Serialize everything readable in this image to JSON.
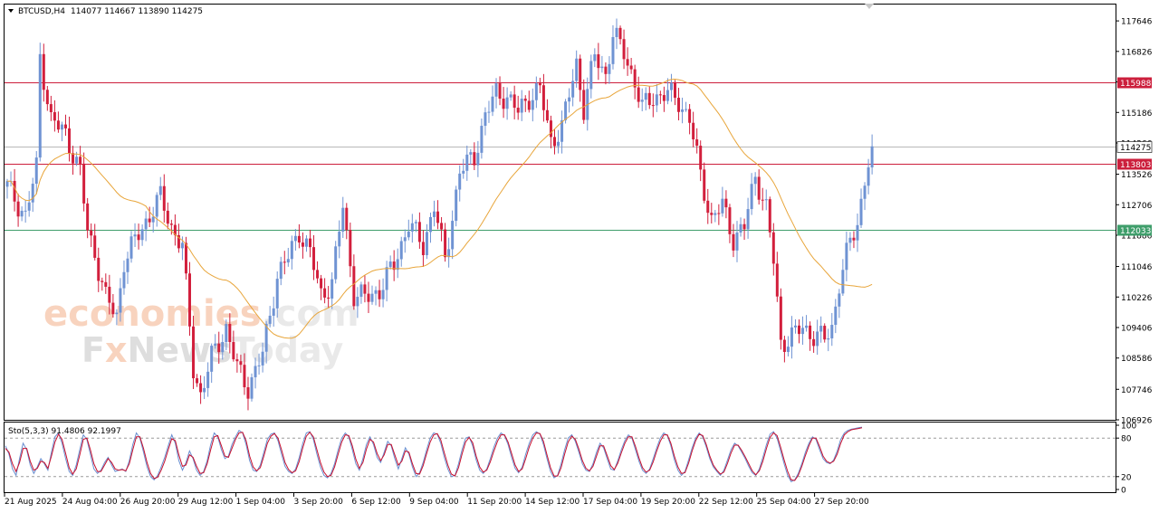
{
  "header": {
    "symbol": "BTCUSD,H4",
    "ohlc": "114077 114667 113890 114275"
  },
  "watermark": {
    "line1_main": "economies",
    "line1_suffix": ".com",
    "line2_prefix": "F",
    "line2_mid": "News",
    "line2_suffix": "Today"
  },
  "chart_data": [
    {
      "type": "candlestick",
      "title": "BTCUSD,H4",
      "ylim": [
        106926,
        118086
      ],
      "yticks": [
        "117646",
        "116826",
        "116006",
        "115186",
        "114366",
        "113526",
        "112706",
        "111886",
        "111046",
        "110226",
        "109406",
        "108586",
        "107746",
        "106926"
      ],
      "xticks": [
        "21 Aug 2025",
        "24 Aug 04:00",
        "26 Aug 20:00",
        "29 Aug 12:00",
        "1 Sep 04:00",
        "3 Sep 20:00",
        "6 Sep 12:00",
        "9 Sep 04:00",
        "11 Sep 20:00",
        "14 Sep 12:00",
        "17 Sep 04:00",
        "19 Sep 20:00",
        "22 Sep 12:00",
        "25 Sep 04:00",
        "27 Sep 20:00"
      ],
      "current_price": "114275",
      "levels": [
        {
          "label": "115988",
          "value": 115988,
          "color": "#cc1f3c"
        },
        {
          "label": "113803",
          "value": 113803,
          "color": "#cc1f3c"
        },
        {
          "label": "112033",
          "value": 112033,
          "color": "#3f9e6b"
        }
      ],
      "anchors": [
        [
          0,
          113200
        ],
        [
          5,
          112400
        ],
        [
          8,
          113700
        ],
        [
          9,
          116700
        ],
        [
          12,
          115000
        ],
        [
          16,
          114600
        ],
        [
          20,
          113600
        ],
        [
          22,
          112000
        ],
        [
          24,
          111400
        ],
        [
          27,
          110200
        ],
        [
          30,
          109700
        ],
        [
          32,
          111200
        ],
        [
          36,
          111900
        ],
        [
          40,
          112600
        ],
        [
          42,
          112900
        ],
        [
          45,
          112100
        ],
        [
          48,
          111600
        ],
        [
          51,
          108300
        ],
        [
          53,
          107600
        ],
        [
          56,
          108600
        ],
        [
          60,
          109400
        ],
        [
          63,
          108300
        ],
        [
          66,
          107800
        ],
        [
          70,
          108700
        ],
        [
          74,
          110800
        ],
        [
          77,
          111300
        ],
        [
          80,
          112000
        ],
        [
          83,
          111400
        ],
        [
          86,
          110300
        ],
        [
          89,
          110600
        ],
        [
          92,
          112700
        ],
        [
          95,
          110300
        ],
        [
          98,
          110200
        ],
        [
          102,
          110400
        ],
        [
          106,
          111100
        ],
        [
          110,
          112200
        ],
        [
          114,
          111600
        ],
        [
          117,
          112700
        ],
        [
          120,
          111200
        ],
        [
          124,
          113600
        ],
        [
          128,
          114000
        ],
        [
          131,
          115100
        ],
        [
          134,
          115700
        ],
        [
          137,
          115600
        ],
        [
          140,
          115200
        ],
        [
          143,
          115600
        ],
        [
          146,
          115800
        ],
        [
          149,
          114400
        ],
        [
          152,
          114800
        ],
        [
          156,
          116500
        ],
        [
          158,
          115300
        ],
        [
          161,
          116700
        ],
        [
          164,
          116200
        ],
        [
          166,
          117300
        ],
        [
          169,
          116800
        ],
        [
          172,
          116000
        ],
        [
          174,
          115300
        ],
        [
          177,
          115600
        ],
        [
          181,
          115700
        ],
        [
          184,
          115500
        ],
        [
          187,
          115000
        ],
        [
          190,
          113500
        ],
        [
          193,
          112300
        ],
        [
          196,
          112700
        ],
        [
          199,
          111800
        ],
        [
          202,
          112100
        ],
        [
          205,
          113500
        ],
        [
          208,
          112600
        ],
        [
          210,
          111200
        ],
        [
          212,
          109000
        ],
        [
          214,
          109100
        ],
        [
          218,
          109400
        ],
        [
          221,
          109200
        ],
        [
          224,
          109100
        ],
        [
          226,
          109400
        ],
        [
          228,
          110600
        ],
        [
          231,
          111700
        ],
        [
          233,
          112200
        ],
        [
          235,
          113400
        ],
        [
          237,
          114275
        ]
      ],
      "ma": {
        "name": "",
        "period": 30,
        "color": "#e8a53a"
      }
    },
    {
      "type": "line",
      "title": "Sto(5,3,3) 91.4806 92.1997",
      "ylim": [
        0,
        100
      ],
      "levels": [
        {
          "label": "80",
          "value": 80
        },
        {
          "label": "20",
          "value": 20
        }
      ],
      "yticks": [
        "100",
        "80",
        "20",
        "0"
      ],
      "series": [
        {
          "name": "",
          "color": "#6a8fd0",
          "values": [
            68,
            55,
            32,
            22,
            48,
            72,
            62,
            38,
            25,
            35,
            48,
            40,
            30,
            58,
            82,
            88,
            72,
            48,
            28,
            22,
            38,
            62,
            85,
            78,
            55,
            32,
            25,
            30,
            42,
            50,
            38,
            28,
            30,
            32,
            28,
            45,
            70,
            88,
            80,
            58,
            35,
            20,
            15,
            22,
            35,
            50,
            68,
            85,
            72,
            45,
            30,
            42,
            60,
            48,
            30,
            22,
            28,
            45,
            70,
            88,
            82,
            62,
            48,
            52,
            70,
            82,
            92,
            88,
            70,
            45,
            30,
            28,
            38,
            58,
            78,
            86,
            88,
            76,
            55,
            36,
            28,
            25,
            32,
            50,
            72,
            88,
            90,
            78,
            55,
            35,
            22,
            18,
            25,
            40,
            62,
            80,
            88,
            82,
            62,
            40,
            30,
            48,
            70,
            82,
            70,
            50,
            42,
            58,
            75,
            68,
            48,
            32,
            48,
            65,
            55,
            35,
            20,
            26,
            42,
            62,
            80,
            88,
            86,
            72,
            50,
            32,
            20,
            22,
            40,
            62,
            80,
            82,
            68,
            46,
            30,
            25,
            32,
            48,
            66,
            80,
            88,
            84,
            70,
            50,
            33,
            26,
            35,
            55,
            72,
            85,
            90,
            86,
            70,
            48,
            28,
            18,
            22,
            40,
            62,
            80,
            85,
            75,
            58,
            40,
            30,
            28,
            40,
            58,
            72,
            65,
            48,
            32,
            30,
            45,
            62,
            76,
            85,
            80,
            62,
            44,
            30,
            25,
            32,
            48,
            65,
            80,
            88,
            84,
            68,
            46,
            30,
            22,
            28,
            46,
            65,
            80,
            88,
            82,
            66,
            48,
            35,
            28,
            22,
            30,
            46,
            62,
            72,
            68,
            58,
            48,
            36,
            26,
            22,
            32,
            50,
            70,
            86,
            90,
            80,
            60,
            40,
            22,
            12,
            15,
            25,
            40,
            58,
            72,
            82,
            78,
            62,
            48,
            42,
            40,
            46,
            60,
            78,
            88,
            92,
            94,
            95,
            96,
            97
          ]
        },
        {
          "name": "",
          "color": "#c8102e",
          "values": [
            64,
            58,
            40,
            28,
            42,
            64,
            64,
            44,
            30,
            33,
            44,
            42,
            33,
            52,
            74,
            86,
            78,
            56,
            34,
            24,
            32,
            54,
            78,
            80,
            62,
            40,
            28,
            28,
            38,
            48,
            42,
            32,
            30,
            31,
            29,
            40,
            62,
            82,
            82,
            64,
            42,
            25,
            17,
            19,
            30,
            44,
            62,
            79,
            76,
            54,
            36,
            38,
            54,
            50,
            36,
            25,
            26,
            40,
            62,
            82,
            84,
            68,
            52,
            50,
            64,
            78,
            88,
            89,
            76,
            52,
            35,
            29,
            34,
            52,
            72,
            83,
            87,
            80,
            62,
            42,
            31,
            26,
            29,
            44,
            65,
            83,
            89,
            82,
            62,
            42,
            27,
            20,
            22,
            35,
            55,
            74,
            85,
            84,
            68,
            47,
            33,
            42,
            63,
            78,
            74,
            56,
            45,
            54,
            70,
            70,
            54,
            38,
            44,
            60,
            58,
            40,
            25,
            24,
            37,
            56,
            74,
            85,
            87,
            77,
            57,
            38,
            24,
            21,
            34,
            55,
            74,
            81,
            73,
            52,
            35,
            27,
            30,
            43,
            60,
            75,
            85,
            85,
            74,
            56,
            38,
            28,
            32,
            48,
            66,
            80,
            88,
            87,
            75,
            54,
            34,
            21,
            21,
            34,
            55,
            74,
            83,
            78,
            63,
            45,
            33,
            29,
            36,
            52,
            68,
            68,
            53,
            37,
            31,
            41,
            57,
            72,
            82,
            82,
            67,
            49,
            34,
            27,
            30,
            43,
            60,
            75,
            85,
            85,
            72,
            52,
            35,
            25,
            26,
            41,
            60,
            76,
            86,
            84,
            70,
            52,
            38,
            30,
            24,
            27,
            41,
            57,
            69,
            69,
            61,
            51,
            40,
            29,
            23,
            29,
            44,
            64,
            81,
            88,
            84,
            66,
            46,
            28,
            15,
            14,
            22,
            36,
            53,
            68,
            80,
            80,
            67,
            52,
            44,
            41,
            44,
            55,
            72,
            85,
            90,
            93,
            94,
            95,
            96
          ]
        }
      ]
    }
  ]
}
